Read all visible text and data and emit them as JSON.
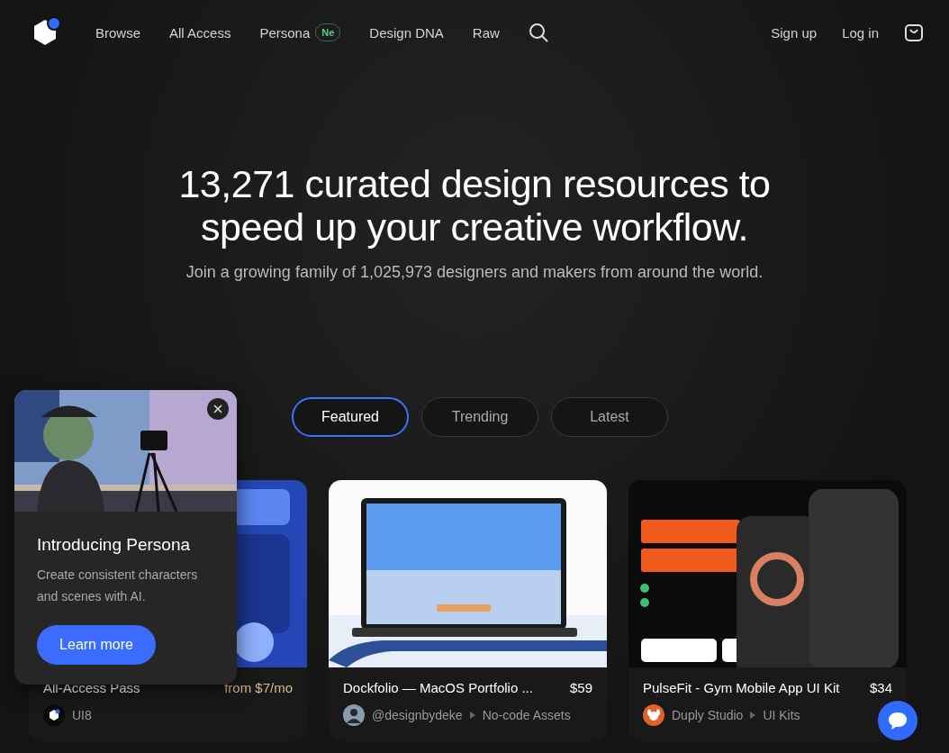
{
  "nav": {
    "links": [
      {
        "label": "Browse"
      },
      {
        "label": "All Access"
      },
      {
        "label": "Persona",
        "badge": "Ne"
      },
      {
        "label": "Design DNA"
      },
      {
        "label": "Raw"
      }
    ],
    "sign_up": "Sign up",
    "log_in": "Log in"
  },
  "hero": {
    "title": "13,271 curated design resources to speed up your creative workflow.",
    "subtitle": "Join a growing family of 1,025,973 designers and makers from around the world."
  },
  "tabs": [
    {
      "label": "Featured",
      "selected": true
    },
    {
      "label": "Trending",
      "selected": false
    },
    {
      "label": "Latest",
      "selected": false
    }
  ],
  "cards": [
    {
      "kind": "logo",
      "title": "All-Access Pass",
      "price": "from $7/mo",
      "price_highlight": true,
      "author": "UI8"
    },
    {
      "title": "Dockfolio — MacOS Portfolio ...",
      "price": "$59",
      "price_highlight": false,
      "author": "@designbydeke",
      "category": "No-code Assets"
    },
    {
      "kind": "dog",
      "title": "PulseFit - Gym Mobile App UI Kit",
      "price": "$34",
      "price_highlight": false,
      "author": "Duply Studio",
      "category": "UI Kits"
    }
  ],
  "popup": {
    "title": "Introducing Persona",
    "text": "Create consistent characters and scenes with AI.",
    "button": "Learn more"
  }
}
